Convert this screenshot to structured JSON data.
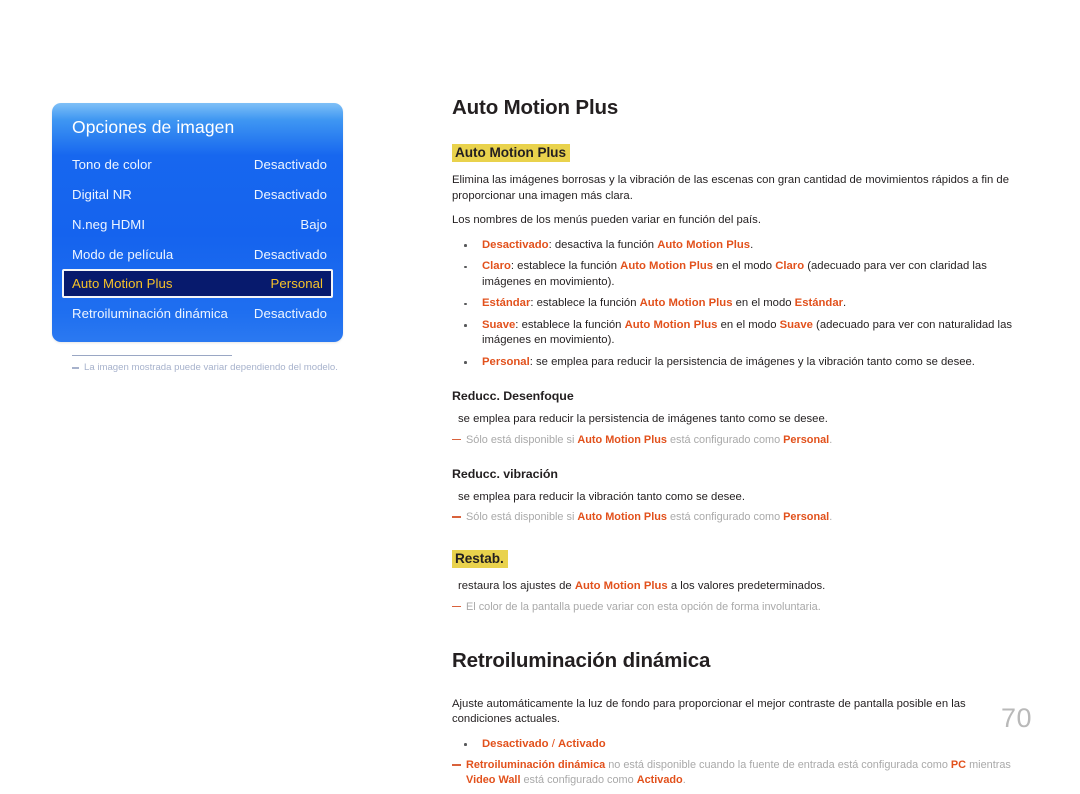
{
  "osd": {
    "title": "Opciones de imagen",
    "rows": [
      {
        "label": "Tono de color",
        "value": "Desactivado",
        "selected": false
      },
      {
        "label": "Digital NR",
        "value": "Desactivado",
        "selected": false
      },
      {
        "label": "N.neg HDMI",
        "value": "Bajo",
        "selected": false
      },
      {
        "label": "Modo de película",
        "value": "Desactivado",
        "selected": false
      },
      {
        "label": "Auto Motion Plus",
        "value": "Personal",
        "selected": true
      },
      {
        "label": "Retroiluminación dinámica",
        "value": "Desactivado",
        "selected": false
      }
    ],
    "caption": "La imagen mostrada puede variar dependiendo del modelo."
  },
  "content": {
    "h1_auto_motion_plus": "Auto Motion Plus",
    "highlight_auto_motion_plus": "Auto Motion Plus",
    "intro_p1": "Elimina las imágenes borrosas y la vibración de las escenas con gran cantidad de movimientos rápidos a fin de proporcionar una imagen más clara.",
    "intro_p2": "Los nombres de los menús pueden variar en función del país.",
    "bullets": [
      {
        "term": "Desactivado",
        "text_after": ": desactiva la función ",
        "bold_ref": "Auto Motion Plus",
        "tail": "."
      },
      {
        "term": "Claro",
        "text_after": ": establece la función ",
        "bold_ref": "Auto Motion Plus",
        "mid": " en el modo ",
        "mode": "Claro",
        "tail": " (adecuado para ver con claridad las imágenes en movimiento)."
      },
      {
        "term": "Estándar",
        "text_after": ": establece la función ",
        "bold_ref": "Auto Motion Plus",
        "mid": " en el modo ",
        "mode": "Estándar",
        "tail": "."
      },
      {
        "term": "Suave",
        "text_after": ": establece la función ",
        "bold_ref": "Auto Motion Plus",
        "mid": " en el modo ",
        "mode": "Suave",
        "tail": " (adecuado para ver con naturalidad las imágenes en movimiento)."
      },
      {
        "term": "Personal",
        "text_after": ": se emplea para reducir la persistencia de imágenes y la vibración tanto como se desee.",
        "bold_ref": "",
        "tail": ""
      }
    ],
    "reducc_desenfoque": {
      "heading": "Reducc. Desenfoque",
      "body": "se emplea para reducir la persistencia de imágenes tanto como se desee.",
      "note_pre": "Sólo está disponible si ",
      "note_ref": "Auto Motion Plus",
      "note_mid": " está configurado como ",
      "note_val": "Personal",
      "note_tail": "."
    },
    "reducc_vibracion": {
      "heading": "Reducc. vibración",
      "body": "se emplea para reducir la vibración tanto como se desee.",
      "note_pre": "Sólo está disponible si ",
      "note_ref": "Auto Motion Plus",
      "note_mid": " está configurado como ",
      "note_val": "Personal",
      "note_tail": "."
    },
    "restab": {
      "heading": "Restab.",
      "body_pre": "restaura los ajustes de ",
      "body_ref": "Auto Motion Plus",
      "body_post": " a los valores predeterminados.",
      "note": "El color de la pantalla puede variar con esta opción de forma involuntaria."
    },
    "retroiluminacion": {
      "h1": "Retroiluminación dinámica",
      "body": "Ajuste automáticamente la luz de fondo para proporcionar el mejor contraste de pantalla posible en las condiciones actuales.",
      "bullet_off": "Desactivado",
      "bullet_sep": " / ",
      "bullet_on": "Activado",
      "note_ref1": "Retroiluminación dinámica",
      "note_mid1": " no está disponible cuando la fuente de entrada está configurada como ",
      "note_ref2": "PC",
      "note_mid2": " mientras ",
      "note_ref3": "Video Wall",
      "note_mid3": " está configurado como ",
      "note_ref4": "Activado",
      "note_tail": "."
    }
  },
  "page_number": "70",
  "colors": {
    "accent_red": "#e2511c",
    "highlight_yellow": "#e9d24c",
    "osd_blue": "#1563ee",
    "osd_selected_bg": "#071a6d",
    "osd_selected_text": "#f7c228",
    "note_gray": "#a9a9a9"
  }
}
